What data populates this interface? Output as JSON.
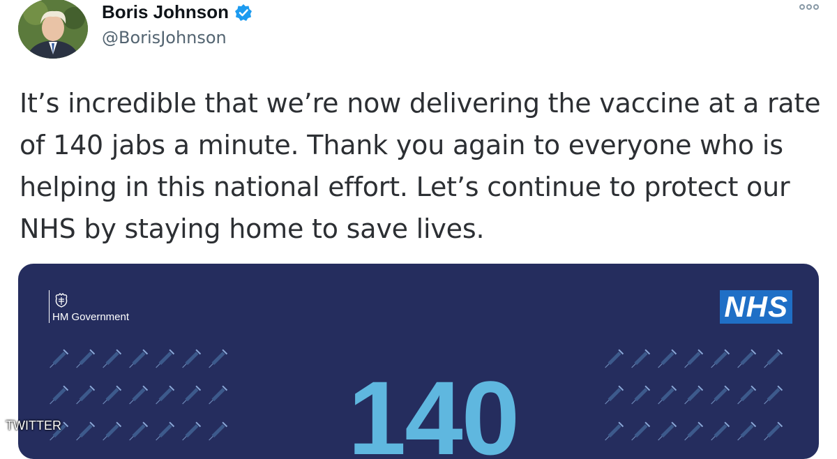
{
  "author": {
    "name": "Boris Johnson",
    "handle": "@BorisJohnson",
    "verified": true
  },
  "icons": {
    "verified": "verified-badge-icon",
    "more": "more-options-icon",
    "crest": "royal-crest-icon",
    "syringe": "syringe-icon"
  },
  "tweet": {
    "text": "It’s incredible that we’re now delivering the vaccine at a rate of 140 jabs a minute. Thank you again to everyone who is helping in this national effort. Let’s continue to protect our NHS by staying home to save lives."
  },
  "card": {
    "gov_label": "HM Government",
    "nhs_label": "NHS",
    "big_number": "140",
    "background": "#252d5e",
    "number_color": "#5fb7df",
    "nhs_color": "#1f6fc6"
  },
  "watermark": {
    "source": "TWITTER"
  },
  "colors": {
    "verified": "#1d9bf0",
    "handle": "#536471"
  }
}
